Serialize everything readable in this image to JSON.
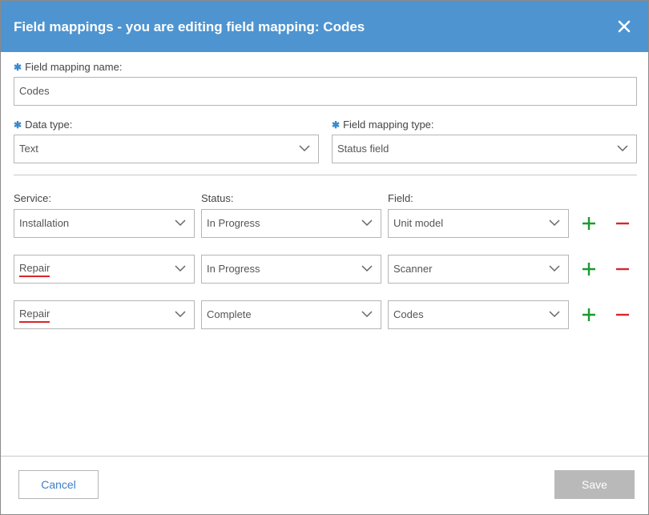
{
  "header": {
    "title": "Field mappings - you are editing field mapping: Codes"
  },
  "form": {
    "required_marker": "✱",
    "name_label": "Field mapping name:",
    "name_value": "Codes",
    "data_type_label": "Data type:",
    "data_type_value": "Text",
    "mapping_type_label": "Field mapping type:",
    "mapping_type_value": "Status field"
  },
  "mappings": {
    "service_header": "Service:",
    "status_header": "Status:",
    "field_header": "Field:",
    "rows": [
      {
        "service": "Installation",
        "status": "In Progress",
        "field": "Unit model"
      },
      {
        "service": "Repair",
        "status": "In Progress",
        "field": "Scanner"
      },
      {
        "service": "Repair",
        "status": "Complete",
        "field": "Codes"
      }
    ]
  },
  "footer": {
    "cancel_label": "Cancel",
    "save_label": "Save"
  },
  "colors": {
    "header_bg": "#4e94d0",
    "add_icon": "#1a9b2f",
    "remove_icon": "#d9262b",
    "link_blue": "#3a7fc4",
    "save_disabled": "#b9b9b9"
  }
}
